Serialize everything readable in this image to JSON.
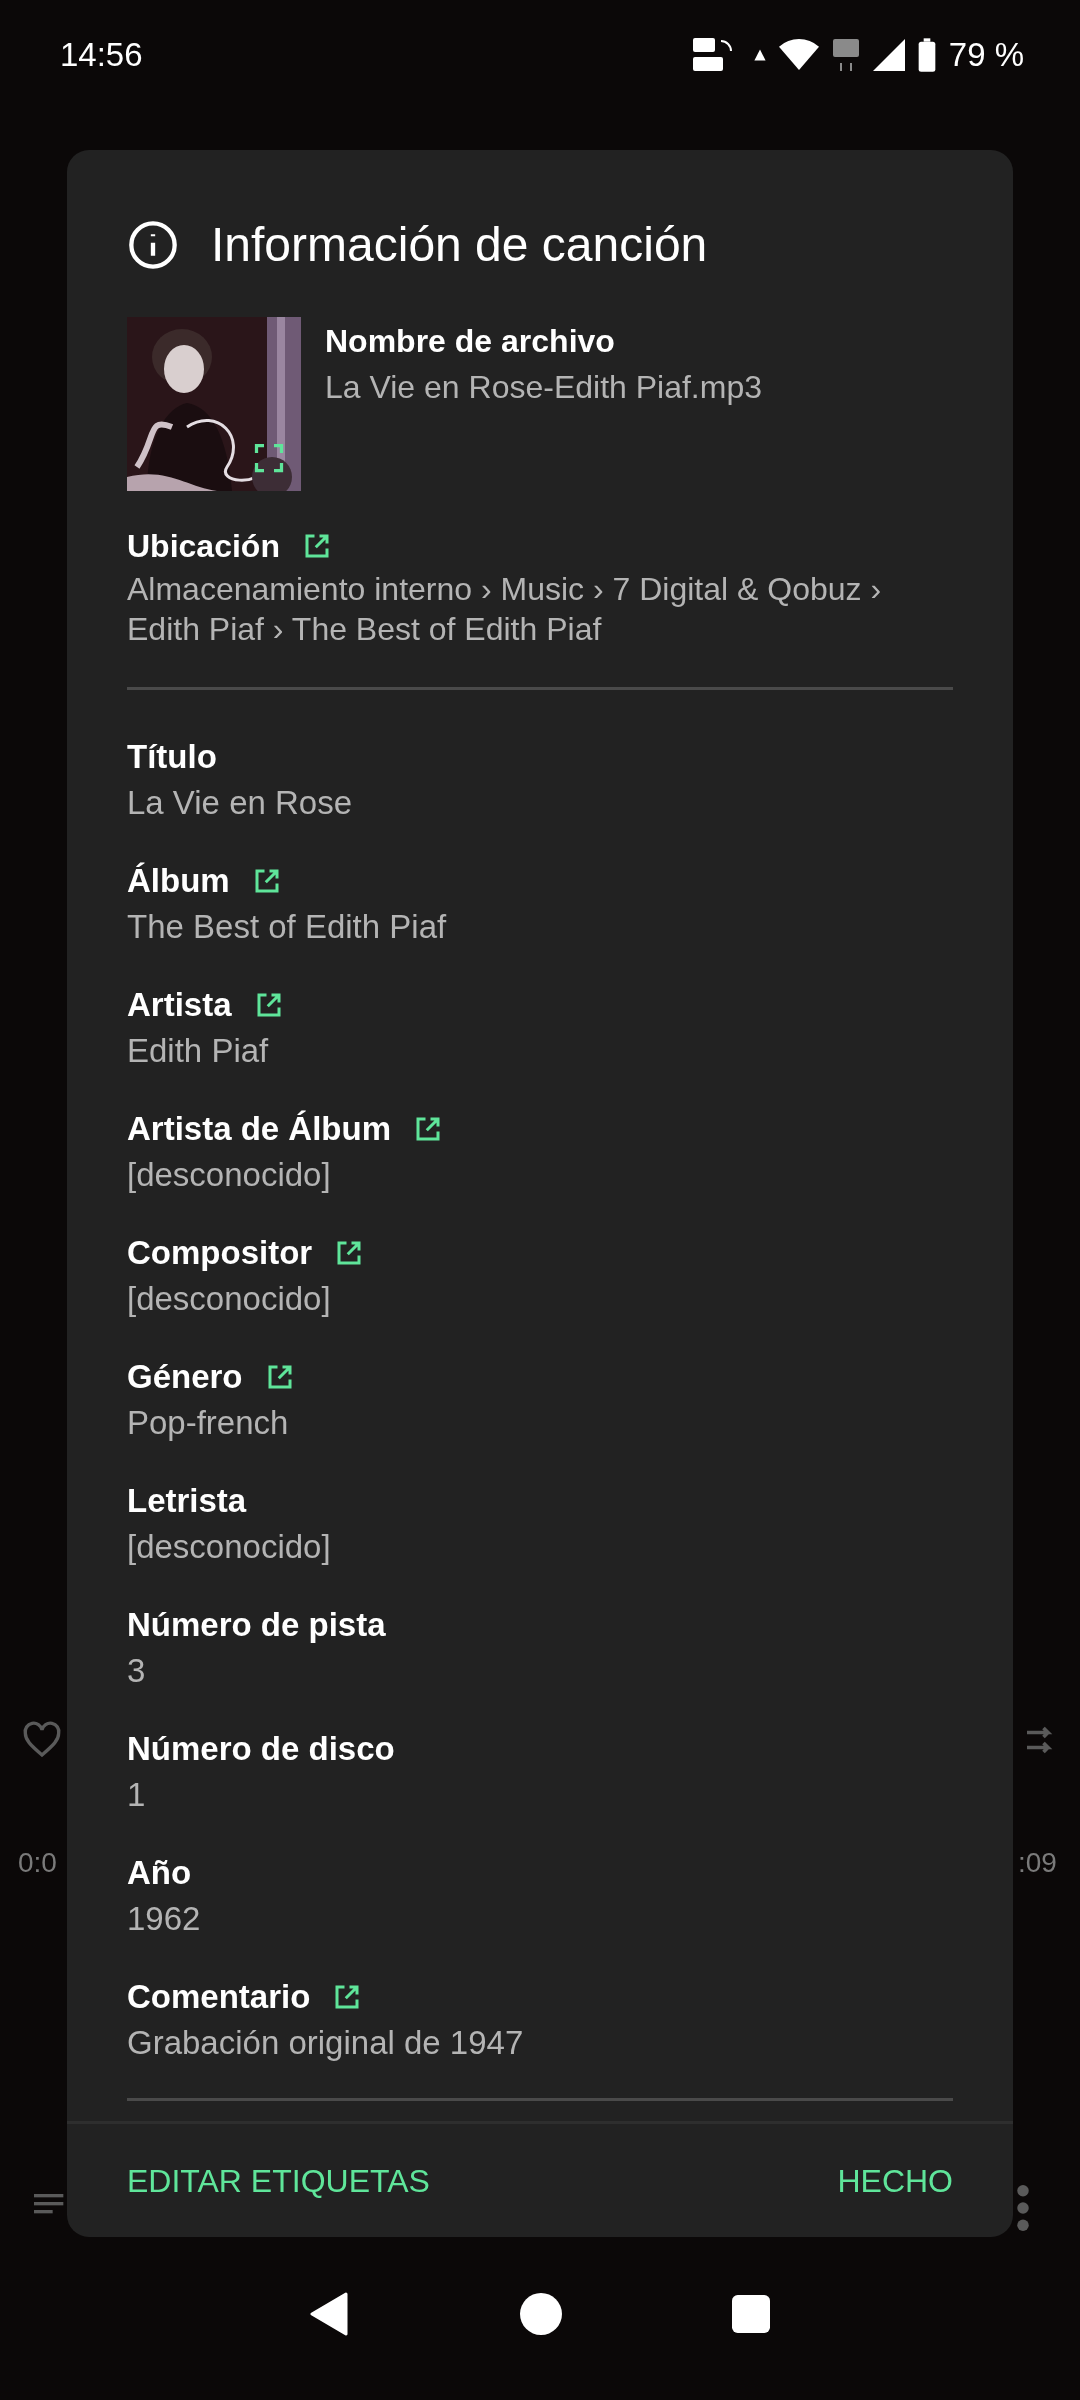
{
  "status_bar": {
    "time": "14:56",
    "battery": "79 %"
  },
  "player": {
    "elapsed": "0:0",
    "total": ":09"
  },
  "dialog": {
    "title": "Información de canción",
    "file": {
      "label": "Nombre de archivo",
      "value": "La Vie en Rose-Edith Piaf.mp3"
    },
    "location": {
      "label": "Ubicación",
      "path": "Almacenamiento interno › Music › 7 Digital & Qobuz › Edith Piaf › The Best of Edith Piaf",
      "link": true
    },
    "fields": [
      {
        "label": "Título",
        "value": "La Vie en Rose",
        "link": false
      },
      {
        "label": "Álbum",
        "value": "The Best of Edith Piaf",
        "link": true
      },
      {
        "label": "Artista",
        "value": "Edith Piaf",
        "link": true
      },
      {
        "label": "Artista de Álbum",
        "value": "[desconocido]",
        "link": true
      },
      {
        "label": "Compositor",
        "value": "[desconocido]",
        "link": true
      },
      {
        "label": "Género",
        "value": "Pop-french",
        "link": true
      },
      {
        "label": "Letrista",
        "value": "[desconocido]",
        "link": false
      },
      {
        "label": "Número de pista",
        "value": "3",
        "link": false
      },
      {
        "label": "Número de disco",
        "value": "1",
        "link": false
      },
      {
        "label": "Año",
        "value": "1962",
        "link": false
      },
      {
        "label": "Comentario",
        "value": "Grabación original de 1947",
        "link": true
      }
    ],
    "buttons": [
      "EDITAR ETIQUETAS",
      "HECHO"
    ]
  }
}
